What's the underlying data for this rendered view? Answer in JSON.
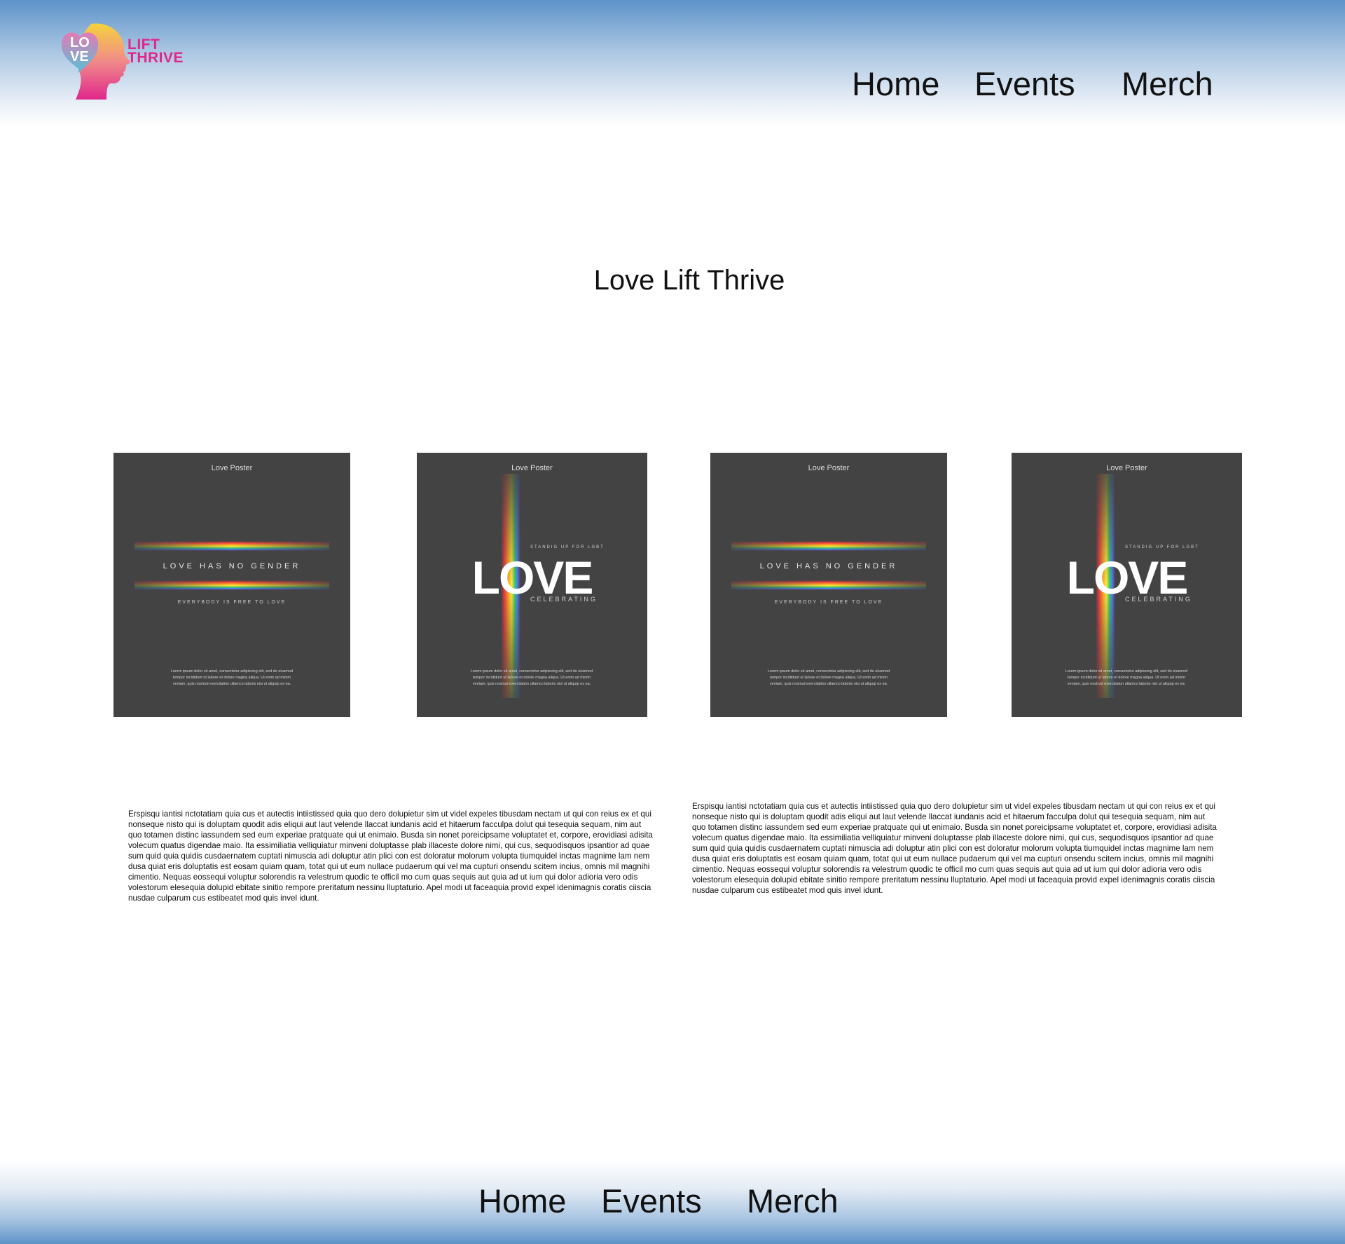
{
  "brand": {
    "logo_love_top": "LO",
    "logo_love_bottom": "VE",
    "logo_lift": "LIFT",
    "logo_thrive": "THRIVE"
  },
  "header_nav": [
    "Home",
    "Events",
    "Merch"
  ],
  "main": {
    "title": "Love Lift Thrive"
  },
  "posters": [
    {
      "label": "Love Poster",
      "variant": "no-gender",
      "headline": "LOVE HAS NO GENDER",
      "tagline": "EVERYBODY IS FREE TO LOVE",
      "lorem": "Lorem ipsum dolor sit amet, consectetur adipiscing elit, sed do eiusmod tempor incididunt ut labore et dolore magna aliqua. Ut enim ad minim veniam, quis nostrud exercitation ullamco laboris nisi ut aliquip ex ea."
    },
    {
      "label": "Love Poster",
      "variant": "love",
      "headline": "LOVE",
      "top_line": "STANDIG UP FOR LGBT",
      "bottom_line": "CELEBRATING",
      "lorem": "Lorem ipsum dolor sit amet, consectetur adipiscing elit, sed do eiusmod tempor incididunt ut labore et dolore magna aliqua. Ut enim ad minim veniam, quis nostrud exercitation ullamco laboris nisi ut aliquip ex ea."
    },
    {
      "label": "Love Poster",
      "variant": "no-gender",
      "headline": "LOVE HAS NO GENDER",
      "tagline": "EVERYBODY IS FREE TO LOVE",
      "lorem": "Lorem ipsum dolor sit amet, consectetur adipiscing elit, sed do eiusmod tempor incididunt ut labore et dolore magna aliqua. Ut enim ad minim veniam, quis nostrud exercitation ullamco laboris nisi ut aliquip ex ea."
    },
    {
      "label": "Love Poster",
      "variant": "love",
      "headline": "LOVE",
      "top_line": "STANDIG UP FOR LGBT",
      "bottom_line": "CELEBRATING",
      "lorem": "Lorem ipsum dolor sit amet, consectetur adipiscing elit, sed do eiusmod tempor incididunt ut labore et dolore magna aliqua. Ut enim ad minim veniam, quis nostrud exercitation ullamco laboris nisi ut aliquip ex ea."
    }
  ],
  "paragraphs": [
    "Erspisqu iantisi nctotatiam quia cus et autectis intiistissed quia quo dero dolupietur sim ut videl expeles tibusdam nectam ut qui con reius ex et qui nonseque nisto qui is doluptam quodit adis eliqui aut laut velende llaccat iundanis acid et hitaerum facculpa dolut qui tesequia sequam, nim aut quo totamen distinc iassundem sed eum experiae pratquate qui ut enimaio. Busda sin nonet poreicipsame voluptatet et, corpore, erovidiasi adisita volecum quatus digendae maio. Ita essimiliatia velliquiatur minveni doluptasse plab illaceste dolore nimi, qui cus, sequodisquos ipsantior ad quae sum quid quia quidis cusdaernatem cuptati nimuscia adi doluptur atin plici con est doloratur molorum volupta tiumquidel inctas magnime lam nem dusa quiat eris doluptatis est eosam quiam quam, totat qui ut eum nullace pudaerum qui vel ma cupturi onsendu scitem incius, omnis mil magnihi cimentio. Nequas eossequi voluptur solorendis ra velestrum quodic te officil mo cum quas sequis aut quia ad ut ium qui dolor adioria vero odis volestorum elesequia dolupid ebitate sinitio rempore preritatum nessinu lluptaturio. Apel modi ut faceaquia provid expel idenimagnis coratis ciiscia nusdae culparum cus estibeatet mod quis invel idunt.",
    "Erspisqu iantisi nctotatiam quia cus et autectis intiistissed quia quo dero dolupietur sim ut videl expeles tibusdam nectam ut qui con reius ex et qui nonseque nisto qui is doluptam quodit adis eliqui aut laut velende llaccat iundanis acid et hitaerum facculpa dolut qui tesequia sequam, nim aut quo totamen distinc iassundem sed eum experiae pratquate qui ut enimaio. Busda sin nonet poreicipsame voluptatet et, corpore, erovidiasi adisita volecum quatus digendae maio. Ita essimiliatia velliquiatur minveni doluptasse plab illaceste dolore nimi, qui cus, sequodisquos ipsantior ad quae sum quid quia quidis cusdaernatem cuptati nimuscia adi doluptur atin plici con est doloratur molorum volupta tiumquidel inctas magnime lam nem dusa quiat eris doluptatis est eosam quiam quam, totat qui ut eum nullace pudaerum qui vel ma cupturi onsendu scitem incius, omnis mil magnihi cimentio. Nequas eossequi voluptur solorendis ra velestrum quodic te officil mo cum quas sequis aut quia ad ut ium qui dolor adioria vero odis volestorum elesequia dolupid ebitate sinitio rempore preritatum nessinu lluptaturio. Apel modi ut faceaquia provid expel idenimagnis coratis ciiscia nusdae culparum cus estibeatet mod quis invel idunt."
  ],
  "footer_nav": [
    "Home",
    "Events",
    "Merch"
  ],
  "colors": {
    "header_blue": "#5d93c9",
    "poster_bg": "#434344",
    "brand_pink": "#e0278b",
    "brand_yellow": "#f5d23c",
    "brand_teal": "#52c1d6"
  }
}
